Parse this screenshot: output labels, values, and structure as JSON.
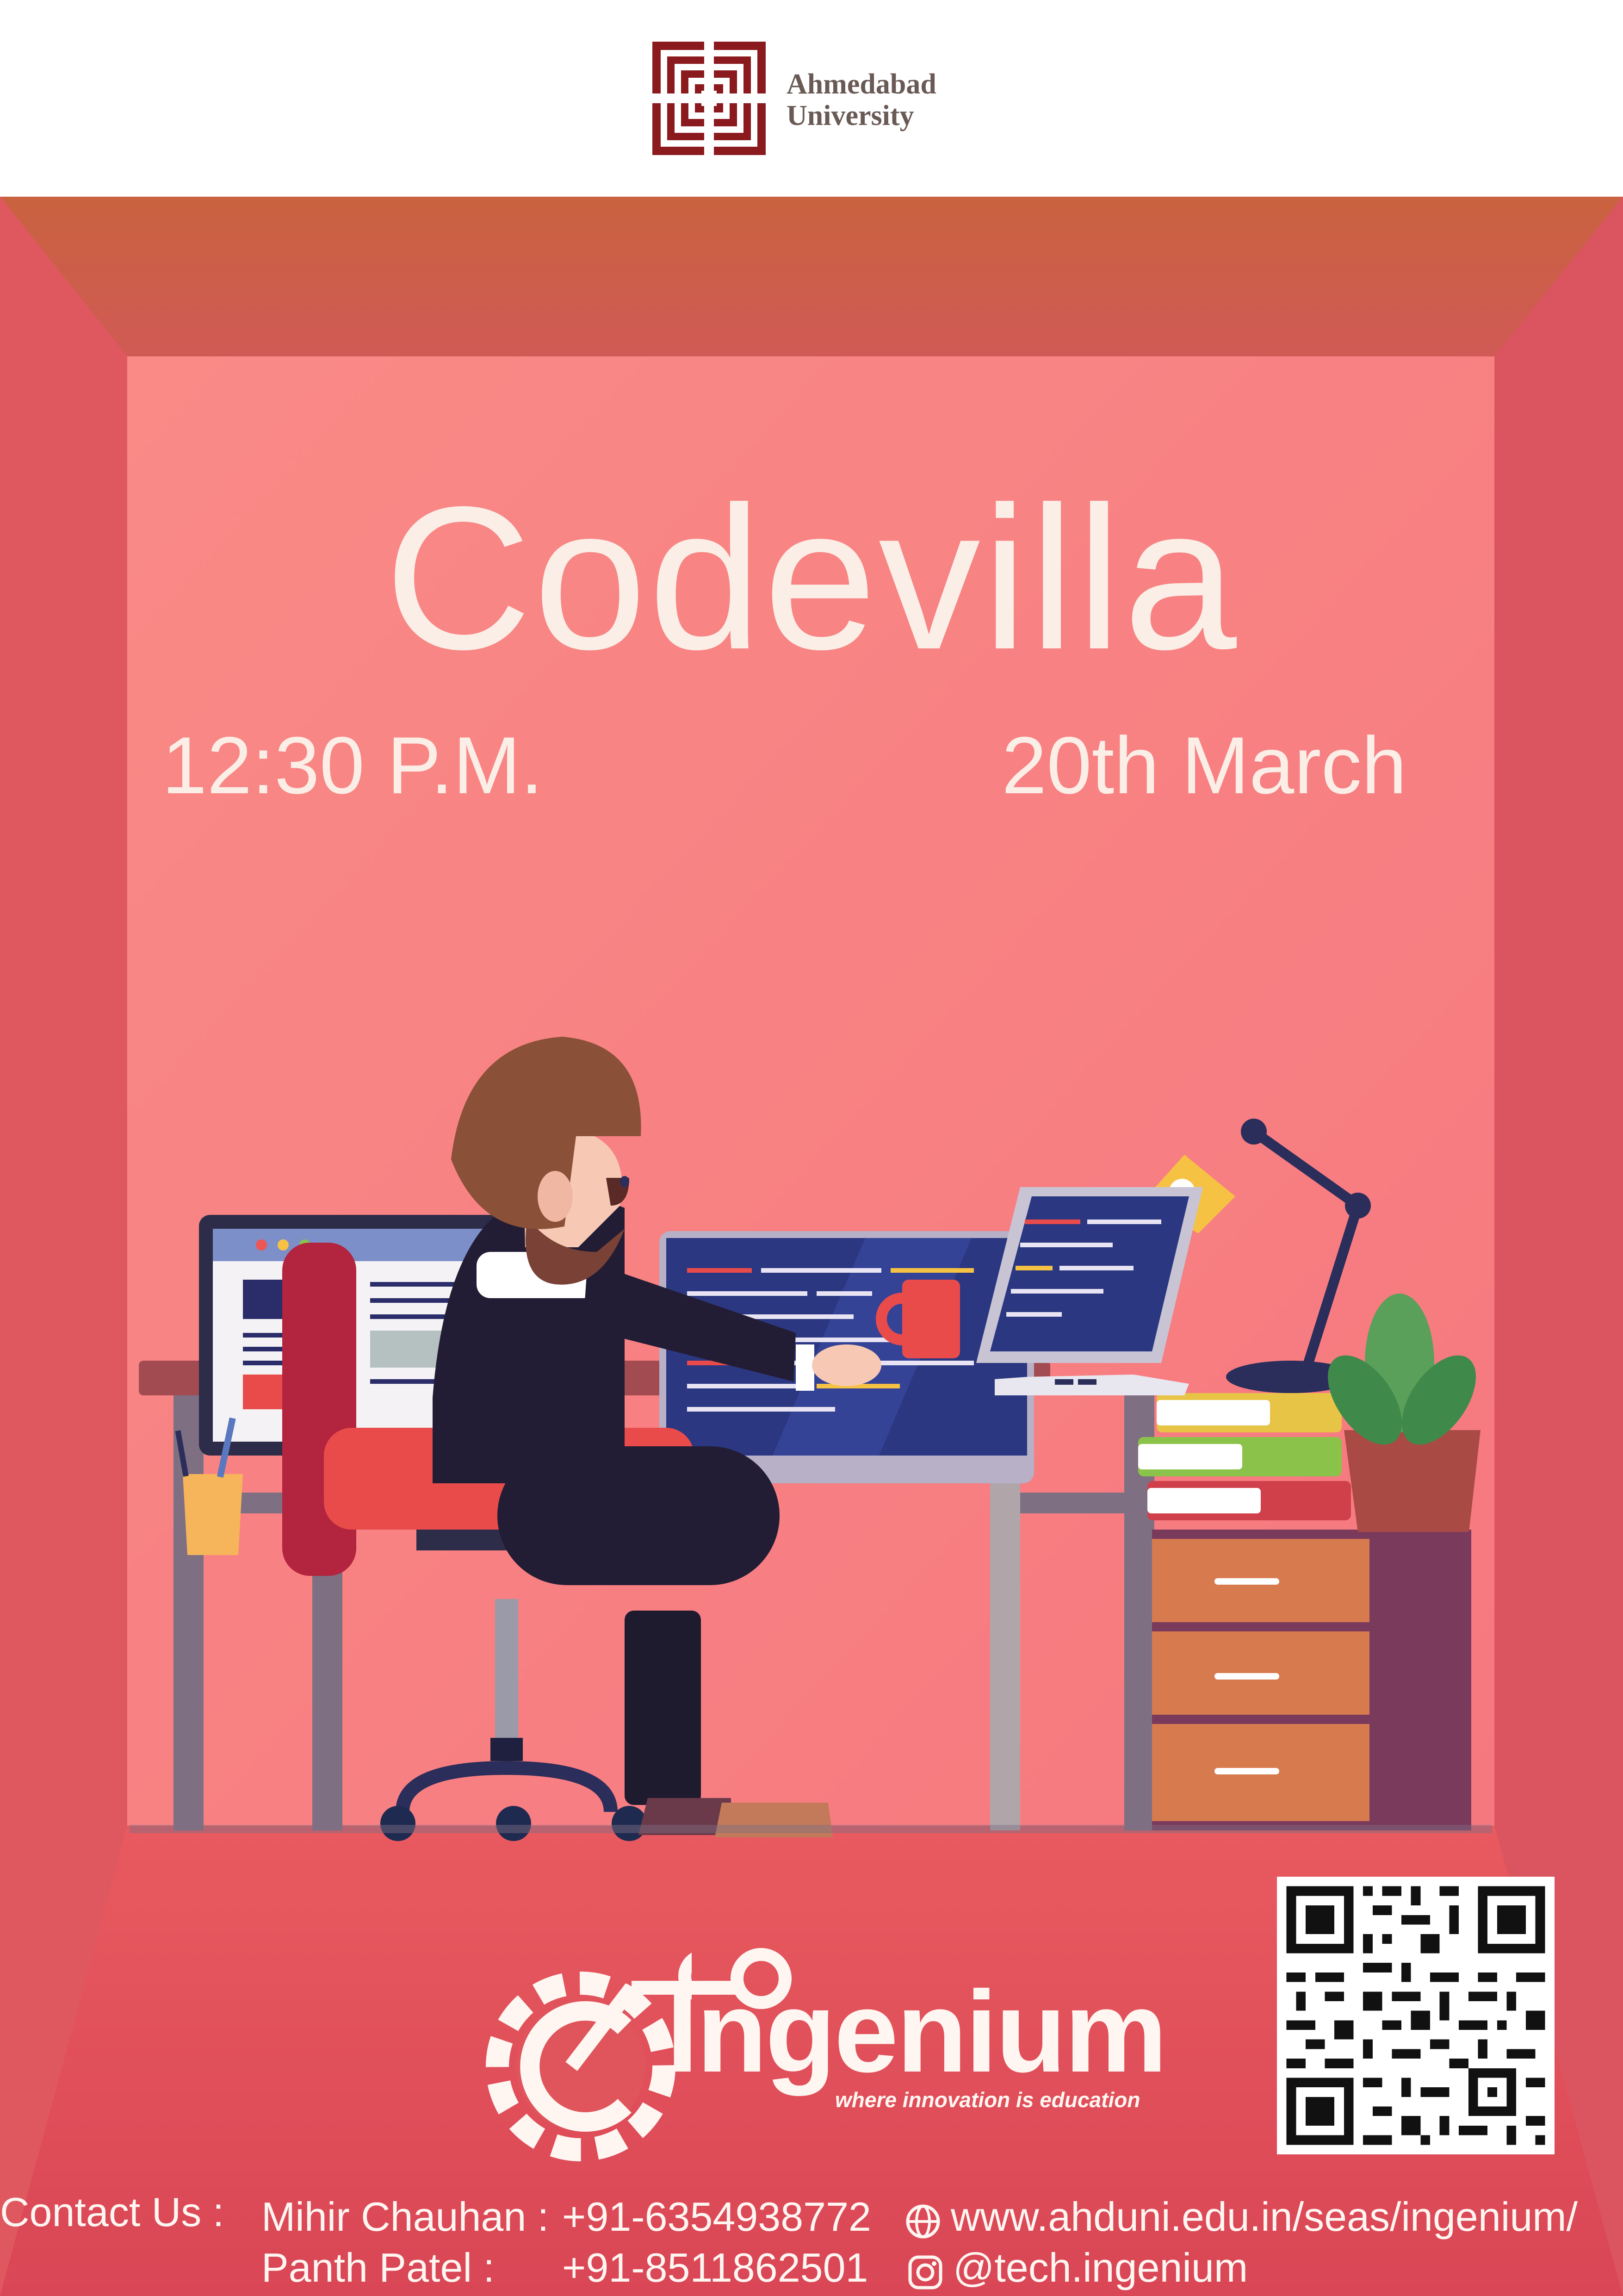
{
  "header": {
    "logo_line1": "Ahmedabad",
    "logo_line2": "University"
  },
  "event": {
    "title": "Codevilla",
    "time": "12:30 P.M.",
    "date": "20th March"
  },
  "brand": {
    "name": "Ingenium",
    "tagline": "where innovation is education"
  },
  "contact": {
    "label": "Contact Us :",
    "people": [
      {
        "name": "Mihir Chauhan :",
        "phone": "+91-6354938772"
      },
      {
        "name": "Panth Patel :",
        "phone": "+91-8511862501"
      }
    ],
    "website": "www.ahduni.edu.in/seas/ingenium/",
    "instagram": "@tech.ingenium"
  },
  "icons": {
    "web": "globe-icon",
    "social": "instagram-icon"
  },
  "colors": {
    "wall": "#f77e7f",
    "side": "#e25a60",
    "floor": "#dd4f58",
    "text": "#fbeee6",
    "logo": "#8b1a1e"
  }
}
